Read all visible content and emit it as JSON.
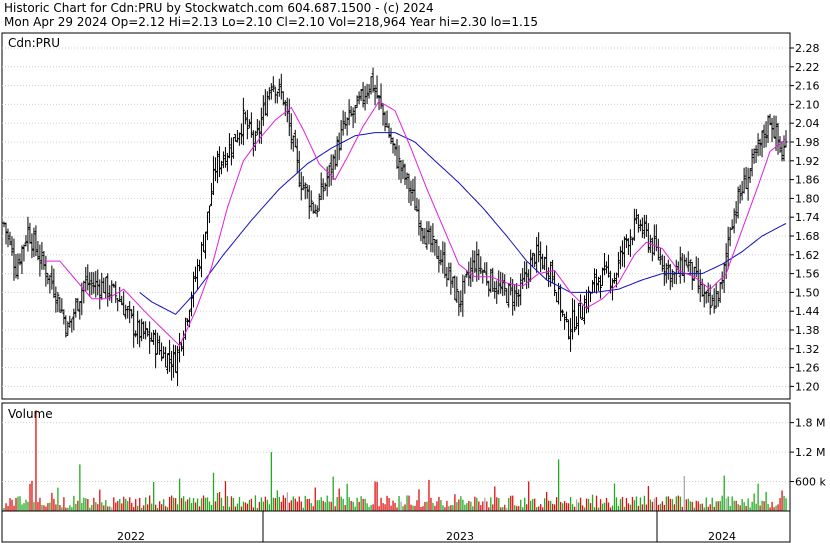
{
  "header": {
    "title_line": "Historic Chart for Cdn:PRU by Stockwatch.com 604.687.1500 - (c) 2024",
    "stats_line": "Mon Apr 29 2024  Op=2.12  Hi=2.13  Lo=2.10  Cl=2.10  Vol=218,964  Year hi=2.30  lo=1.15"
  },
  "price_panel": {
    "label": "Cdn:PRU"
  },
  "volume_panel": {
    "label": "Volume"
  },
  "colors": {
    "background": "#ffffff",
    "bars": "#000000",
    "grid": "#d0d0d0",
    "short_ma": "#e020e0",
    "long_ma": "#1010c0",
    "volume_up": "#22aa22",
    "volume_down": "#dd1111",
    "volume_flat": "#aaaaaa"
  },
  "chart_data": {
    "type": "ohlc",
    "symbol": "Cdn:PRU",
    "y_ticks": [
      "2.28",
      "2.22",
      "2.16",
      "2.10",
      "2.04",
      "1.98",
      "1.92",
      "1.86",
      "1.80",
      "1.74",
      "1.68",
      "1.62",
      "1.56",
      "1.50",
      "1.44",
      "1.38",
      "1.32",
      "1.26",
      "1.20"
    ],
    "ylim": [
      1.15,
      2.31
    ],
    "volume_ticks": [
      "1.8 M",
      "1.2 M",
      "600 k"
    ],
    "volume_ylim": [
      0,
      2200000
    ],
    "x_year_labels": [
      "2022",
      "2023",
      "2024"
    ],
    "price_anchors": [
      [
        0,
        1.72
      ],
      [
        6,
        1.58
      ],
      [
        12,
        1.7
      ],
      [
        18,
        1.61
      ],
      [
        25,
        1.52
      ],
      [
        32,
        1.38
      ],
      [
        40,
        1.53
      ],
      [
        50,
        1.52
      ],
      [
        58,
        1.48
      ],
      [
        66,
        1.38
      ],
      [
        74,
        1.35
      ],
      [
        80,
        1.3
      ],
      [
        86,
        1.28
      ],
      [
        92,
        1.44
      ],
      [
        100,
        1.66
      ],
      [
        106,
        1.9
      ],
      [
        114,
        1.97
      ],
      [
        120,
        2.05
      ],
      [
        126,
        1.97
      ],
      [
        134,
        2.18
      ],
      [
        140,
        2.12
      ],
      [
        148,
        1.87
      ],
      [
        156,
        1.76
      ],
      [
        164,
        1.9
      ],
      [
        170,
        2.02
      ],
      [
        178,
        2.1
      ],
      [
        184,
        2.18
      ],
      [
        190,
        2.07
      ],
      [
        196,
        1.94
      ],
      [
        204,
        1.82
      ],
      [
        212,
        1.67
      ],
      [
        220,
        1.6
      ],
      [
        228,
        1.47
      ],
      [
        236,
        1.6
      ],
      [
        242,
        1.55
      ],
      [
        250,
        1.5
      ],
      [
        258,
        1.49
      ],
      [
        266,
        1.62
      ],
      [
        274,
        1.58
      ],
      [
        282,
        1.38
      ],
      [
        290,
        1.45
      ],
      [
        298,
        1.55
      ],
      [
        306,
        1.55
      ],
      [
        312,
        1.67
      ],
      [
        318,
        1.72
      ],
      [
        324,
        1.66
      ],
      [
        330,
        1.6
      ],
      [
        336,
        1.55
      ],
      [
        342,
        1.6
      ],
      [
        348,
        1.52
      ],
      [
        354,
        1.45
      ],
      [
        360,
        1.52
      ],
      [
        364,
        1.72
      ],
      [
        370,
        1.83
      ],
      [
        378,
        1.95
      ],
      [
        384,
        2.06
      ],
      [
        390,
        1.94
      ],
      [
        392,
        1.97
      ]
    ],
    "long_ma": [
      [
        68,
        1.5
      ],
      [
        74,
        1.47
      ],
      [
        80,
        1.45
      ],
      [
        86,
        1.43
      ],
      [
        96,
        1.5
      ],
      [
        110,
        1.62
      ],
      [
        124,
        1.73
      ],
      [
        138,
        1.83
      ],
      [
        152,
        1.91
      ],
      [
        164,
        1.96
      ],
      [
        176,
        2.0
      ],
      [
        186,
        2.01
      ],
      [
        196,
        2.01
      ],
      [
        206,
        1.98
      ],
      [
        216,
        1.92
      ],
      [
        228,
        1.85
      ],
      [
        240,
        1.77
      ],
      [
        252,
        1.68
      ],
      [
        262,
        1.6
      ],
      [
        272,
        1.54
      ],
      [
        284,
        1.5
      ],
      [
        296,
        1.5
      ],
      [
        308,
        1.51
      ],
      [
        320,
        1.54
      ],
      [
        330,
        1.56
      ],
      [
        340,
        1.56
      ],
      [
        350,
        1.56
      ],
      [
        360,
        1.59
      ],
      [
        370,
        1.63
      ],
      [
        380,
        1.68
      ],
      [
        392,
        1.72
      ]
    ],
    "short_ma": [
      [
        20,
        1.6
      ],
      [
        28,
        1.6
      ],
      [
        36,
        1.54
      ],
      [
        44,
        1.48
      ],
      [
        52,
        1.48
      ],
      [
        60,
        1.51
      ],
      [
        66,
        1.47
      ],
      [
        72,
        1.43
      ],
      [
        80,
        1.38
      ],
      [
        88,
        1.33
      ],
      [
        96,
        1.44
      ],
      [
        104,
        1.58
      ],
      [
        112,
        1.77
      ],
      [
        120,
        1.92
      ],
      [
        128,
        1.99
      ],
      [
        136,
        2.05
      ],
      [
        144,
        2.09
      ],
      [
        150,
        2.02
      ],
      [
        158,
        1.91
      ],
      [
        166,
        1.86
      ],
      [
        172,
        1.93
      ],
      [
        180,
        2.03
      ],
      [
        188,
        2.11
      ],
      [
        196,
        2.08
      ],
      [
        204,
        1.96
      ],
      [
        212,
        1.83
      ],
      [
        220,
        1.71
      ],
      [
        228,
        1.59
      ],
      [
        236,
        1.55
      ],
      [
        244,
        1.55
      ],
      [
        252,
        1.53
      ],
      [
        260,
        1.52
      ],
      [
        268,
        1.56
      ],
      [
        276,
        1.57
      ],
      [
        284,
        1.5
      ],
      [
        292,
        1.45
      ],
      [
        300,
        1.48
      ],
      [
        308,
        1.53
      ],
      [
        316,
        1.62
      ],
      [
        322,
        1.66
      ],
      [
        330,
        1.64
      ],
      [
        338,
        1.57
      ],
      [
        346,
        1.55
      ],
      [
        354,
        1.51
      ],
      [
        362,
        1.56
      ],
      [
        370,
        1.7
      ],
      [
        378,
        1.84
      ],
      [
        384,
        1.95
      ],
      [
        392,
        1.99
      ]
    ]
  }
}
